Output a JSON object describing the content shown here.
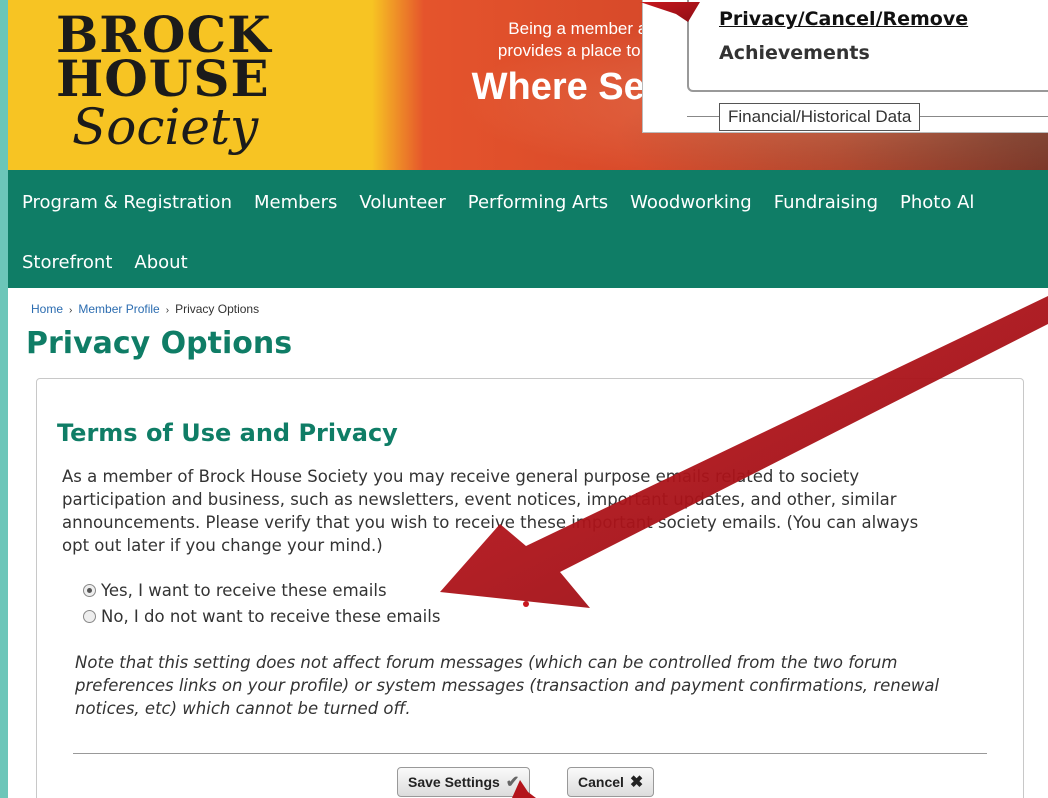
{
  "banner": {
    "logo_line1": "BROCK",
    "logo_line2": "HOUSE",
    "logo_line3": "Society",
    "tagline_line1": "Being a member at B",
    "tagline_line2": "provides a place to bui",
    "tagline_big": "Where Sen"
  },
  "popup": {
    "link_privacy": "Privacy/Cancel/Remove",
    "link_achievements": "Achievements",
    "section_label": "Financial/Historical Data"
  },
  "nav": {
    "row1": [
      "Program & Registration",
      "Members",
      "Volunteer",
      "Performing Arts",
      "Woodworking",
      "Fundraising",
      "Photo Al"
    ],
    "row2": [
      "Storefront",
      "About"
    ]
  },
  "breadcrumb": {
    "home": "Home",
    "member_profile": "Member Profile",
    "current": "Privacy Options",
    "sep": "›"
  },
  "page_title": "Privacy Options",
  "terms": {
    "heading": "Terms of Use and Privacy",
    "paragraph": "As a member of Brock House Society you may receive general purpose emails related to society participation and business, such as newsletters, event notices, important updates, and other, similar announcements. Please verify that you wish to receive these important society emails. (You can always opt out later if you change your mind.)",
    "option_yes": "Yes, I want to receive these emails",
    "option_no": "No, I do not want to receive these emails",
    "selected": "yes",
    "note": "Note that this setting does not affect forum messages (which can be controlled from the two forum preferences links on your profile) or system messages (transaction and payment confirmations, renewal notices, etc) which cannot be turned off."
  },
  "buttons": {
    "save": "Save Settings",
    "cancel": "Cancel"
  },
  "colors": {
    "brand_green": "#0f7d66",
    "page_bg": "#6cc6b9",
    "arrow_red": "#b3141b"
  }
}
